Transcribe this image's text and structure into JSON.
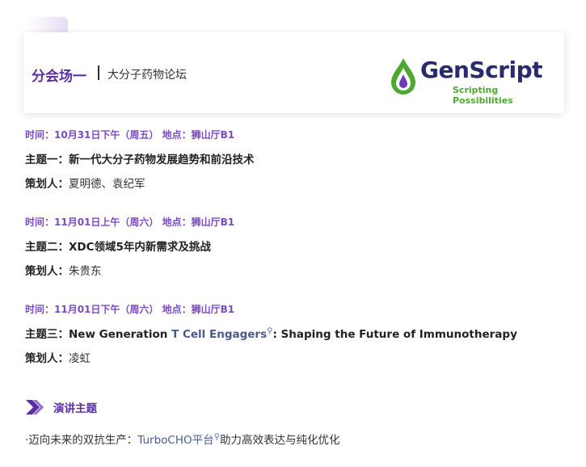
{
  "header": {
    "venue_title": "分会场一",
    "venue_subtitle": "大分子药物论坛",
    "logo": {
      "brand": "GenScript",
      "tagline": "Scripting Possibilities",
      "colors": {
        "brand_text": "#2a2a6e",
        "tagline": "#4fa832",
        "drop_green": "#4fa832",
        "drop_purple": "#6a3fb5"
      }
    }
  },
  "sessions": [
    {
      "time": "时间：10月31日下午（周五） 地点：狮山厅B1",
      "topic_prefix": "主题一：",
      "topic_text": "新一代大分子药物发展趋势和前沿技术",
      "curator_label": "策划人：",
      "curator_names": "夏明德、袁纪军"
    },
    {
      "time": "时间：11月01日上午（周六） 地点：狮山厅B1",
      "topic_prefix": "主题二：",
      "topic_text": "XDC领域5年内新需求及挑战",
      "curator_label": "策划人：",
      "curator_names": "朱贵东"
    },
    {
      "time": "时间：11月01日下午（周六） 地点：狮山厅B1",
      "topic_prefix": "主题三：",
      "topic_before": "New Generation ",
      "topic_link": "T Cell Engagers",
      "topic_after": ": Shaping the Future of Immunotherapy",
      "curator_label": "策划人：",
      "curator_names": "凌虹"
    }
  ],
  "speech_section": {
    "title": "演讲主题",
    "icon": "double-chevron-icon",
    "accent": "#5b2fa0"
  },
  "talk": {
    "prefix": "·迈向未来的双抗生产：",
    "link": "TurboCHO平台",
    "suffix": "助力高效表达与纯化优化"
  },
  "colors": {
    "accent": "#5b2fa0",
    "time": "#7b4bc0",
    "link": "#4a5a8f"
  }
}
